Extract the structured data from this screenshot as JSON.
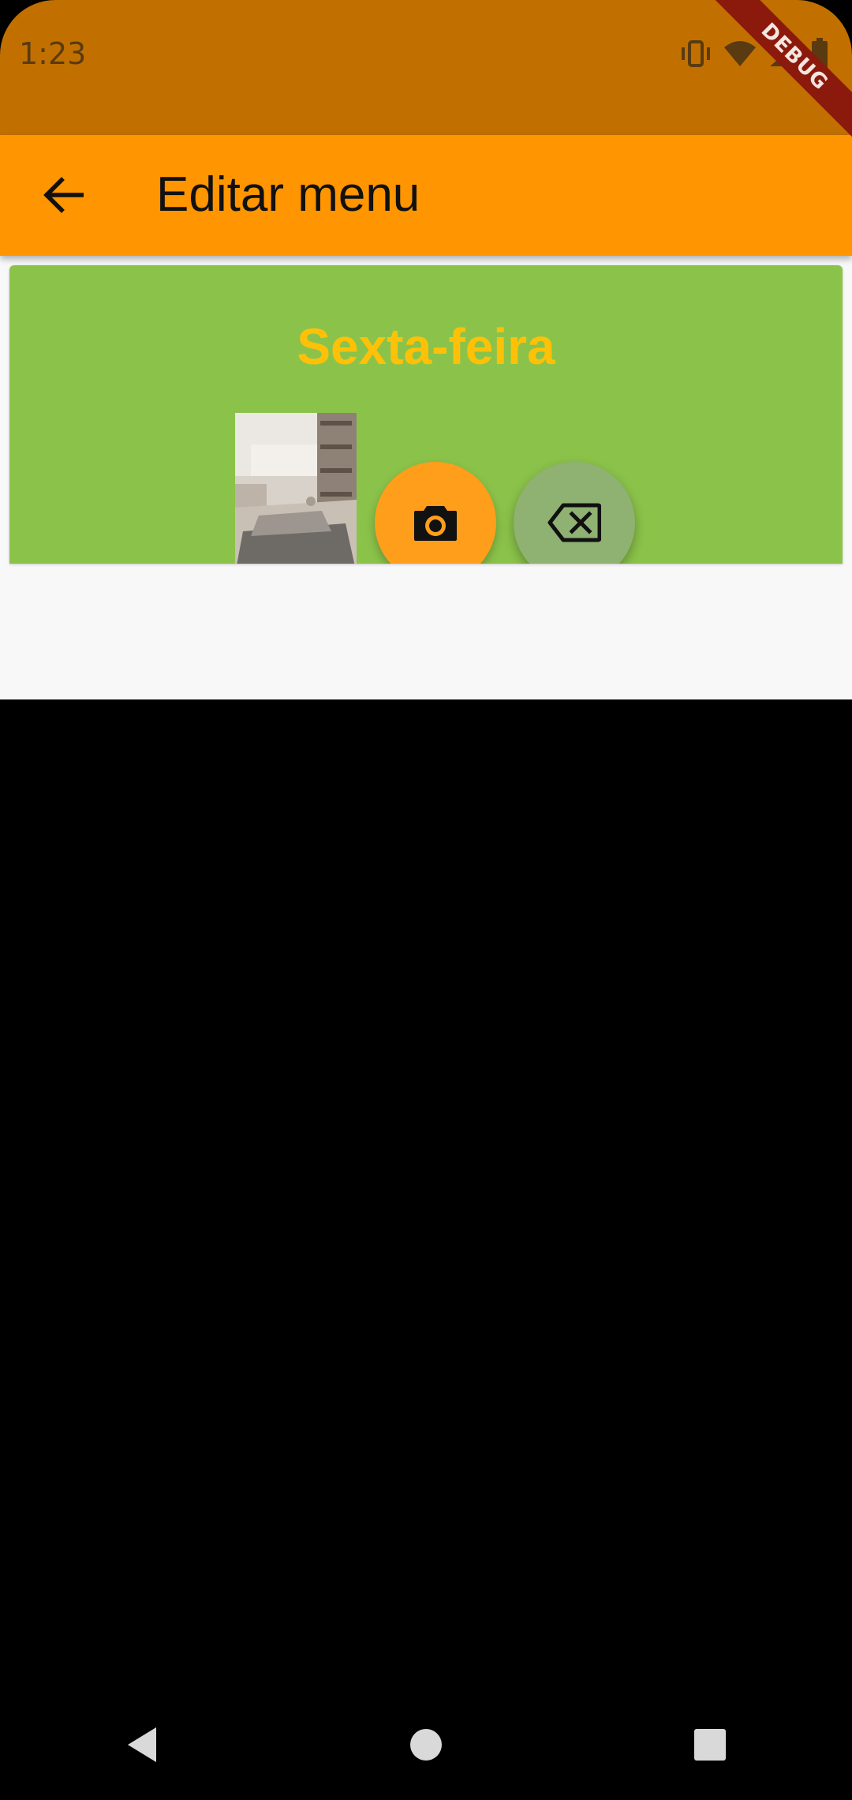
{
  "status_bar": {
    "time": "1:23",
    "icons": [
      "vibrate-icon",
      "wifi-icon",
      "signal-icon",
      "battery-icon"
    ],
    "debug_label": "DEBUG"
  },
  "app_bar": {
    "title": "Editar menu",
    "back_icon": "arrow-left-icon"
  },
  "menu_card": {
    "day": "Sexta-feira",
    "photo_button_icon": "camera-icon",
    "delete_button_icon": "backspace-icon"
  },
  "nav_bar": {
    "buttons": [
      "back-triangle-icon",
      "home-circle-icon",
      "recents-square-icon"
    ]
  },
  "colors": {
    "status_bar": "#c17000",
    "app_bar": "#ff9500",
    "card": "#8bc34a",
    "day_title": "#ffc107",
    "camera_fab": "#ff9e1b",
    "delete_fab": "#8fb272"
  }
}
